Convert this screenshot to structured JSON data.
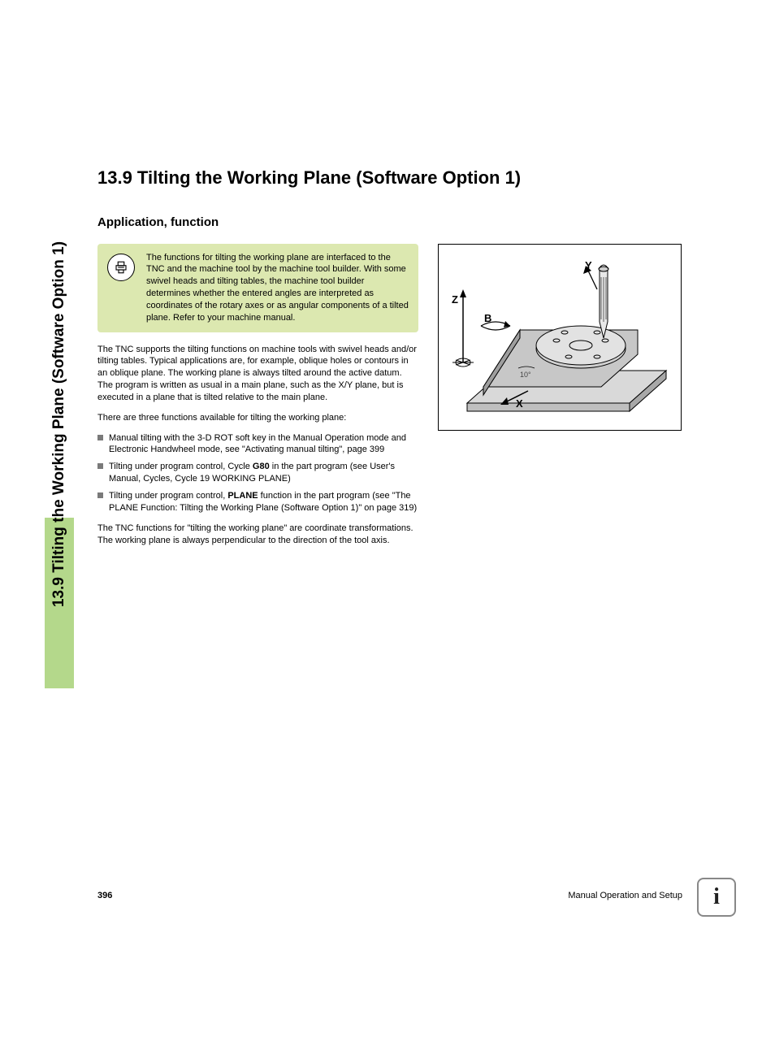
{
  "sidebar": {
    "label": "13.9 Tilting the Working Plane (Software Option 1)"
  },
  "heading": "13.9 Tilting the Working Plane (Software Option 1)",
  "subheading": "Application, function",
  "callout": {
    "text": "The functions for tilting the working plane are interfaced to the TNC and the machine tool by the machine tool builder. With some swivel heads and tilting tables, the machine tool builder determines whether the entered angles are interpreted as coordinates of the rotary axes or as angular components of a tilted plane. Refer to your machine manual."
  },
  "para1": "The TNC supports the tilting functions on machine tools with swivel heads and/or tilting tables. Typical applications are, for example, oblique holes or contours in an oblique plane. The working plane is always tilted around the active datum. The program is written as usual in a main plane, such as the X/Y plane, but is executed in a plane that is tilted relative to the main plane.",
  "para2": "There are three functions available for tilting the working plane:",
  "bullets": {
    "b1": "Manual tilting with the 3-D ROT soft key in the Manual Operation mode and Electronic Handwheel mode, see \"Activating manual tilting\", page 399",
    "b2a": "Tilting under program control, Cycle ",
    "b2bold": "G80",
    "b2b": " in the part program (see User's Manual, Cycles, Cycle 19 WORKING PLANE)",
    "b3a": "Tilting under program control, ",
    "b3bold": "PLANE",
    "b3b": " function in the part program (see \"The PLANE Function: Tilting the Working Plane (Software Option 1)\" on page 319)"
  },
  "para3": "The TNC functions for \"tilting the working plane\" are coordinate transformations. The working plane is always perpendicular to the direction of the tool axis.",
  "figure": {
    "labelZ": "Z",
    "labelY": "Y",
    "labelB": "B",
    "labelX": "X",
    "angle": "10°"
  },
  "footer": {
    "page": "396",
    "section": "Manual Operation and Setup"
  },
  "info_icon": "i"
}
